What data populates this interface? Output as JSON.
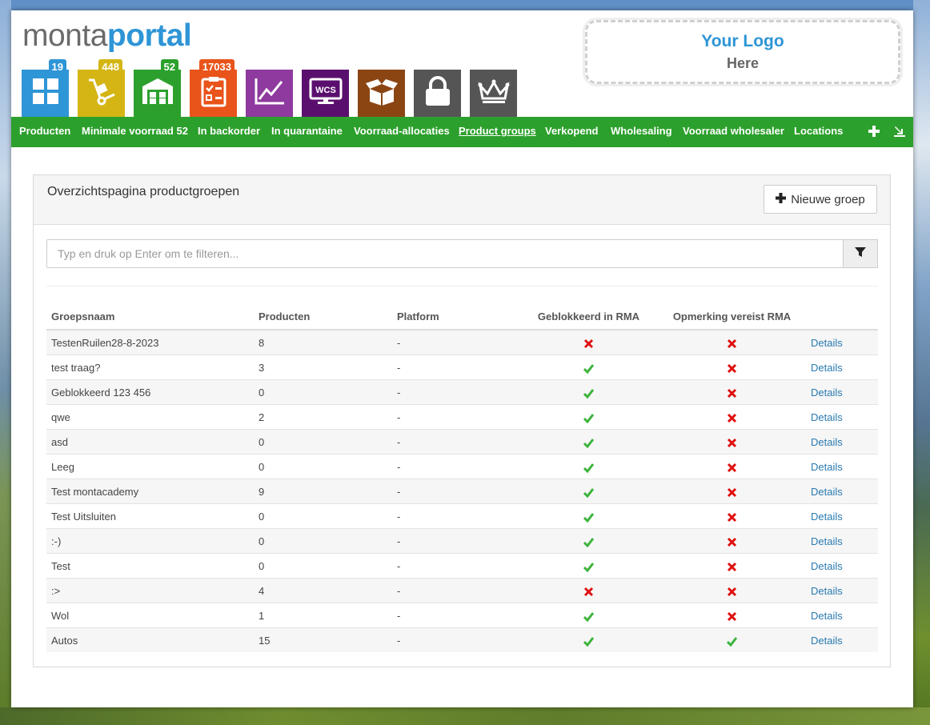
{
  "brand": {
    "part1": "monta",
    "part2": "portal"
  },
  "logo": {
    "title": "Your Logo",
    "subtitle": "Here"
  },
  "tiles": [
    {
      "name": "tile-products",
      "icon": "grid-icon",
      "color": "#2e95d6",
      "badge": "19",
      "badge_color": "#2e95d6"
    },
    {
      "name": "tile-shipping",
      "icon": "hand-truck-icon",
      "color": "#d4b514",
      "badge": "448",
      "badge_color": "#d4b514"
    },
    {
      "name": "tile-warehouse",
      "icon": "warehouse-icon",
      "color": "#2ca02c",
      "badge": "52",
      "badge_color": "#2ca02c"
    },
    {
      "name": "tile-orders",
      "icon": "clipboard-icon",
      "color": "#e9541b",
      "badge": "17033",
      "badge_color": "#e9541b"
    },
    {
      "name": "tile-statistics",
      "icon": "line-chart-icon",
      "color": "#8e3a9e",
      "badge": null
    },
    {
      "name": "tile-wcs",
      "icon": "wcs-monitor-icon",
      "color": "#5a0f6e",
      "badge": null
    },
    {
      "name": "tile-returns",
      "icon": "open-box-icon",
      "color": "#8b4513",
      "badge": null
    },
    {
      "name": "tile-security",
      "icon": "lock-icon",
      "color": "#555555",
      "badge": null
    },
    {
      "name": "tile-premium",
      "icon": "crown-icon",
      "color": "#555555",
      "badge": null
    }
  ],
  "nav": {
    "items": [
      {
        "label": "Producten",
        "active": false
      },
      {
        "label": "Minimale voorraad 52",
        "active": false
      },
      {
        "label": "In backorder",
        "active": false
      },
      {
        "label": "In quarantaine",
        "active": false
      },
      {
        "label": "Voorraad-allocaties",
        "active": false
      },
      {
        "label": "Product groups",
        "active": true
      },
      {
        "label": "Verkopend",
        "active": false
      },
      {
        "label": "Wholesaling",
        "active": false
      },
      {
        "label": "Voorraad wholesaler",
        "active": false
      },
      {
        "label": "Locations",
        "active": false
      }
    ],
    "add_icon": "plus-icon",
    "export_icon": "download-icon"
  },
  "card": {
    "title": "Overzichtspagina productgroepen",
    "new_button": "Nieuwe groep"
  },
  "search": {
    "placeholder": "Typ en druk op Enter om te filteren...",
    "value": ""
  },
  "colors": {
    "check": "#3cb43c",
    "cross": "#e01010",
    "link": "#2a7ab0"
  },
  "table": {
    "headers": [
      "Groepsnaam",
      "Producten",
      "Platform",
      "Geblokkeerd in RMA",
      "Opmerking vereist RMA",
      ""
    ],
    "rows": [
      {
        "name": "TestenRuilen28-8-2023",
        "products": "8",
        "platform": "-",
        "blocked": false,
        "remark": false,
        "action": "Details"
      },
      {
        "name": "test traag?",
        "products": "3",
        "platform": "-",
        "blocked": true,
        "remark": false,
        "action": "Details"
      },
      {
        "name": "Geblokkeerd 123 456",
        "products": "0",
        "platform": "-",
        "blocked": true,
        "remark": false,
        "action": "Details"
      },
      {
        "name": "qwe",
        "products": "2",
        "platform": "-",
        "blocked": true,
        "remark": false,
        "action": "Details"
      },
      {
        "name": "asd",
        "products": "0",
        "platform": "-",
        "blocked": true,
        "remark": false,
        "action": "Details"
      },
      {
        "name": "Leeg",
        "products": "0",
        "platform": "-",
        "blocked": true,
        "remark": false,
        "action": "Details"
      },
      {
        "name": "Test montacademy",
        "products": "9",
        "platform": "-",
        "blocked": true,
        "remark": false,
        "action": "Details"
      },
      {
        "name": "Test Uitsluiten",
        "products": "0",
        "platform": "-",
        "blocked": true,
        "remark": false,
        "action": "Details"
      },
      {
        "name": ":-)",
        "products": "0",
        "platform": "-",
        "blocked": true,
        "remark": false,
        "action": "Details"
      },
      {
        "name": "Test",
        "products": "0",
        "platform": "-",
        "blocked": true,
        "remark": false,
        "action": "Details"
      },
      {
        "name": ":>",
        "products": "4",
        "platform": "-",
        "blocked": false,
        "remark": false,
        "action": "Details"
      },
      {
        "name": "Wol",
        "products": "1",
        "platform": "-",
        "blocked": true,
        "remark": false,
        "action": "Details"
      },
      {
        "name": "Autos",
        "products": "15",
        "platform": "-",
        "blocked": true,
        "remark": true,
        "action": "Details"
      }
    ]
  }
}
